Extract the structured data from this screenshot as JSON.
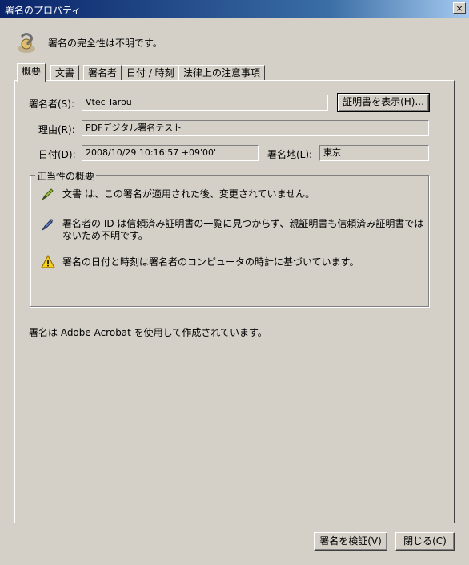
{
  "window": {
    "title": "署名のプロパティ",
    "close_glyph": "×"
  },
  "status": {
    "icon": "signature-unknown-icon",
    "text": "署名の完全性は不明です。"
  },
  "tabs": [
    {
      "label": "概要",
      "active": true
    },
    {
      "label": "文書"
    },
    {
      "label": "署名者"
    },
    {
      "label": "日付 / 時刻"
    },
    {
      "label": "法律上の注意事項"
    }
  ],
  "fields": {
    "signer_label": "署名者(S):",
    "signer_value": "Vtec Tarou",
    "show_cert_button": "証明書を表示(H)...",
    "reason_label": "理由(R):",
    "reason_value": "PDFデジタル署名テスト",
    "date_label": "日付(D):",
    "date_value": "2008/10/29 10:16:57 +09'00'",
    "location_label": "署名地(L):",
    "location_value": "東京"
  },
  "validity": {
    "title": "正当性の概要",
    "items": [
      {
        "icon": "pen-check-icon",
        "text": "文書 は、この署名が適用された後、変更されていません。"
      },
      {
        "icon": "pen-question-icon",
        "text": "署名者の ID は信頼済み証明書の一覧に見つからず、親証明書も信頼済み証明書ではないため不明です。"
      },
      {
        "icon": "warning-icon",
        "text": "署名の日付と時刻は署名者のコンピュータの時計に基づいています。"
      }
    ]
  },
  "footer_note": "署名は Adobe Acrobat を使用して作成されています。",
  "buttons": {
    "verify": "署名を検証(V)",
    "close": "閉じる(C)"
  },
  "colors": {
    "face": "#d4d0c8",
    "title_start": "#0a246a",
    "title_end": "#a6caf0",
    "warning": "#f7d117"
  }
}
